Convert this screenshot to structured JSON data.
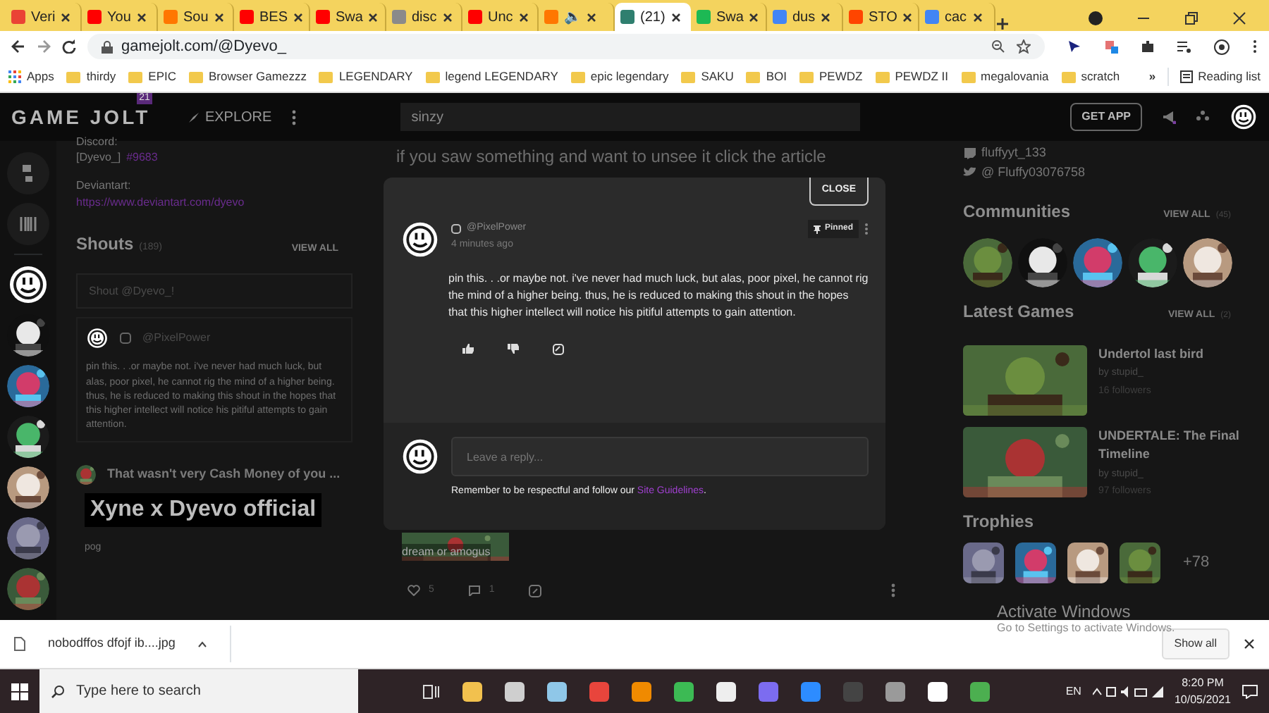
{
  "browser": {
    "tabs": [
      {
        "title": "Veri",
        "color": "#ea4335",
        "selected": false
      },
      {
        "title": "You",
        "color": "#ff0000",
        "selected": false
      },
      {
        "title": "Sou",
        "color": "#ff7700",
        "selected": false
      },
      {
        "title": "BES",
        "color": "#ff0000",
        "selected": false
      },
      {
        "title": "Swa",
        "color": "#ff0000",
        "selected": false
      },
      {
        "title": "disc",
        "color": "#8a8a8a",
        "selected": false
      },
      {
        "title": "Unc",
        "color": "#ff0000",
        "selected": false
      },
      {
        "title": "🔈",
        "color": "#ff7700",
        "selected": false
      },
      {
        "title": "(21)",
        "color": "#2f7f6f",
        "selected": true
      },
      {
        "title": "Swa",
        "color": "#1db954",
        "selected": false
      },
      {
        "title": "dus",
        "color": "#4285f4",
        "selected": false
      },
      {
        "title": "STO",
        "color": "#ff4500",
        "selected": false
      },
      {
        "title": "cac",
        "color": "#4285f4",
        "selected": false
      }
    ],
    "address": "gamejolt.com/@Dyevo_",
    "bookmarks": [
      {
        "label": "Apps",
        "kind": "apps"
      },
      {
        "label": "thirdy",
        "kind": "folder"
      },
      {
        "label": "EPIC",
        "kind": "folder"
      },
      {
        "label": "Browser Gamezzz",
        "kind": "folder"
      },
      {
        "label": "LEGENDARY",
        "kind": "folder"
      },
      {
        "label": "legend LEGENDARY",
        "kind": "folder"
      },
      {
        "label": "epic legendary",
        "kind": "folder"
      },
      {
        "label": "SAKU",
        "kind": "folder"
      },
      {
        "label": "BOI",
        "kind": "folder"
      },
      {
        "label": "PEWDZ",
        "kind": "folder"
      },
      {
        "label": "PEWDZ II",
        "kind": "folder"
      },
      {
        "label": "megalovania",
        "kind": "folder"
      },
      {
        "label": "scratch",
        "kind": "folder"
      }
    ],
    "overflow": "»",
    "reading_list": "Reading list"
  },
  "header": {
    "logo": "GAME JOLT",
    "badge": "21",
    "explore": "EXPLORE",
    "search_value": "sinzy",
    "get_app": "GET APP"
  },
  "sidebar": {
    "avatars": [
      {
        "kind": "smiley"
      },
      {
        "kind": "picture"
      },
      {
        "kind": "picture"
      },
      {
        "kind": "picture"
      },
      {
        "kind": "picture"
      },
      {
        "kind": "picture"
      },
      {
        "kind": "picture"
      }
    ]
  },
  "profile": {
    "discord_label": "Discord:",
    "discord_name": "[Dyevo_]",
    "discord_tag": "#9683",
    "deviantart_label": "Deviantart:",
    "deviantart_link": "https://www.deviantart.com/dyevo"
  },
  "shouts": {
    "title": "Shouts",
    "count": "(189)",
    "view_all": "VIEW ALL",
    "placeholder": "Shout @Dyevo_!",
    "first": {
      "author": "@PixelPower",
      "text": "pin this. . .or maybe not. i've never had much luck, but alas, poor pixel, he cannot rig the mind of a higher being. thus, he is reduced to making this shout in the hopes that this higher intellect will notice his pitiful attempts to gain attention."
    },
    "second": {
      "title": "That wasn't very Cash Money of you ...",
      "banner": "Xyne x Dyevo official",
      "text": "pog"
    }
  },
  "feed": {
    "headline": "if you saw something and want to unsee it click the article",
    "caption": "dream or amogus",
    "likes": "5",
    "comments": "1"
  },
  "right": {
    "twitch": "fluffyyt_133",
    "twitter": "@ Fluffy03076758",
    "communities": {
      "title": "Communities",
      "view_all": "VIEW ALL",
      "count": "(45)",
      "items": [
        {
          "kind": "picture"
        },
        {
          "kind": "picture"
        },
        {
          "kind": "picture"
        },
        {
          "kind": "picture"
        },
        {
          "kind": "picture"
        }
      ]
    },
    "games": {
      "title": "Latest Games",
      "view_all": "VIEW ALL",
      "count": "(2)",
      "items": [
        {
          "title": "Undertol last bird",
          "author": "by stupid_",
          "followers": "16 followers"
        },
        {
          "title": "UNDERTALE: The Final Timeline",
          "author": "by stupid_",
          "followers": "97 followers"
        }
      ]
    },
    "trophies": {
      "title": "Trophies",
      "items": [
        {
          "kind": "picture"
        },
        {
          "kind": "picture"
        },
        {
          "kind": "picture"
        },
        {
          "kind": "picture"
        }
      ],
      "more": "+78"
    }
  },
  "modal": {
    "close": "CLOSE",
    "author": "@PixelPower",
    "time": "4 minutes ago",
    "pinned": "Pinned",
    "text": "pin this. . .or maybe not. i've never had much luck, but alas, poor pixel, he cannot rig the mind of a higher being. thus, he is reduced to making this shout in the hopes that this higher intellect will notice his pitiful attempts to gain attention.",
    "reply_placeholder": "Leave a reply...",
    "rules_text": "Remember to be respectful and follow our",
    "rules_link": "Site Guidelines",
    "rules_end": "."
  },
  "activation": {
    "title": "Activate Windows",
    "subtitle": "Go to Settings to activate Windows."
  },
  "downloads": {
    "file": "nobodffos dfojf ib....jpg",
    "show_all": "Show all"
  },
  "taskbar": {
    "search_placeholder": "Type here to search",
    "apps": [
      {
        "color": "#f2c14e"
      },
      {
        "color": "#cfcfcf"
      },
      {
        "color": "#8fc7e8"
      },
      {
        "color": "#e8453c"
      },
      {
        "color": "#f08a00"
      },
      {
        "color": "#3cba54"
      },
      {
        "color": "#eeeeee"
      },
      {
        "color": "#7c6cf0"
      },
      {
        "color": "#2d8cff"
      },
      {
        "color": "#444444"
      },
      {
        "color": "#9a9a9a"
      },
      {
        "color": "#ffffff"
      },
      {
        "color": "#4caf50"
      }
    ],
    "language": "EN",
    "time": "8:20 PM",
    "date": "10/05/2021"
  }
}
